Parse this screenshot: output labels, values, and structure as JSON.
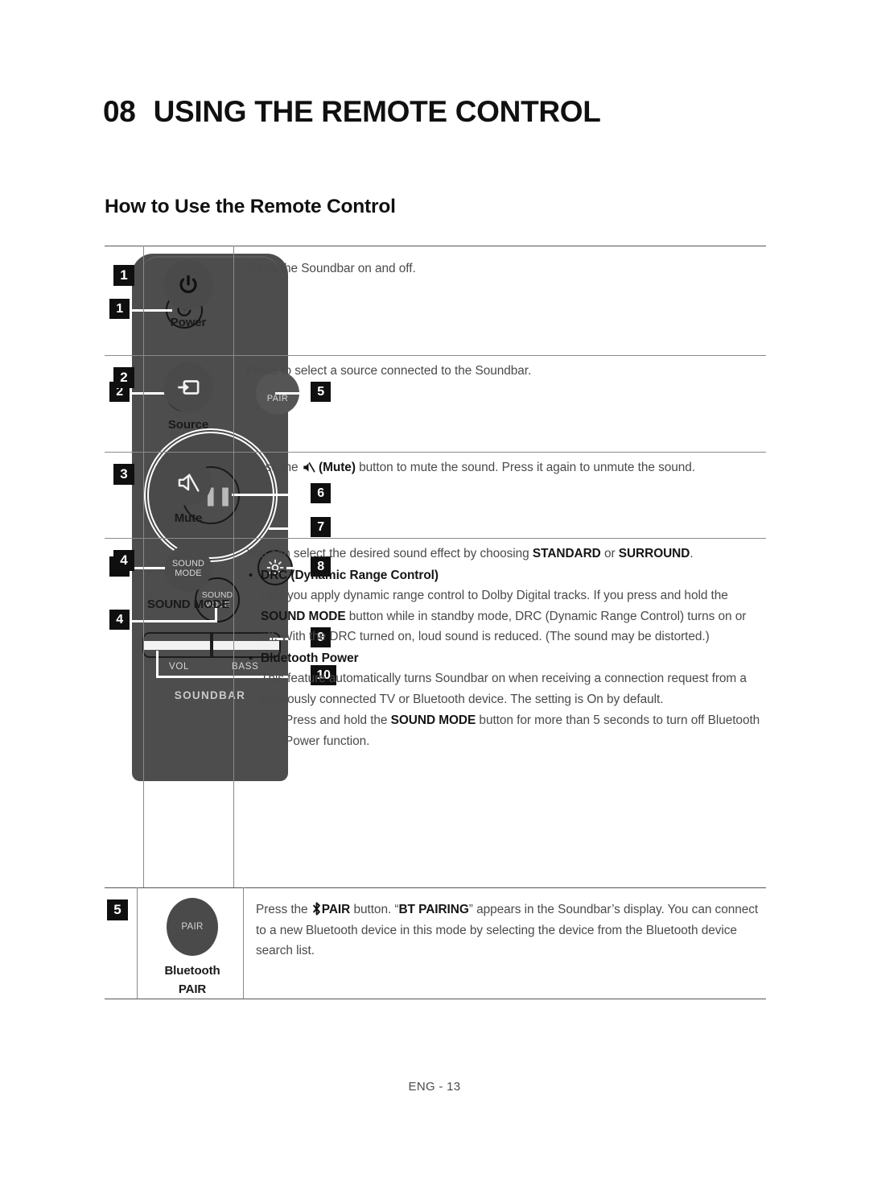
{
  "header": {
    "chapter_number": "08",
    "chapter_title": "USING THE REMOTE CONTROL",
    "section_title": "How to Use the Remote Control"
  },
  "remote_figure": {
    "brand_label": "SOUNDBAR",
    "pair_button_label": "PAIR",
    "sound_mode_label_line1": "SOUND",
    "sound_mode_label_line2": "MODE",
    "vol_label": "VOL",
    "bass_label": "BASS",
    "play_pause_glyph": "▶❚❚",
    "callouts": [
      {
        "number": "1",
        "target": "power-button"
      },
      {
        "number": "2",
        "target": "source-button"
      },
      {
        "number": "3",
        "target": "mute-button"
      },
      {
        "number": "4",
        "target": "sound-mode-button"
      },
      {
        "number": "5",
        "target": "pair-button"
      },
      {
        "number": "6",
        "target": "play-pause-button"
      },
      {
        "number": "7",
        "target": "navigation-ring"
      },
      {
        "number": "8",
        "target": "settings-button"
      },
      {
        "number": "9",
        "target": "volume-bass-rocker"
      },
      {
        "number": "10",
        "target": "rocker-lower-edge"
      }
    ]
  },
  "table": {
    "rows": [
      {
        "number": "1",
        "button_caption": "Power",
        "icon": "power-icon",
        "description": "Turns the Soundbar on and off."
      },
      {
        "number": "2",
        "button_caption": "Source",
        "icon": "source-icon",
        "description": "Press to select a source connected to the Soundbar."
      },
      {
        "number": "3",
        "button_caption": "Mute",
        "icon": "mute-icon",
        "desc_part1": "Press the ",
        "desc_mute_bold": "(Mute)",
        "desc_part2": " button to mute the sound. Press it again to unmute the sound."
      },
      {
        "number": "4",
        "button_caption": "SOUND MODE",
        "icon": "sound-mode-icon",
        "button_label_line1": "SOUND",
        "button_label_line2": "MODE",
        "intro_a": "You can select the desired sound effect by choosing ",
        "intro_standard": "STANDARD",
        "intro_or": " or ",
        "intro_surround": "SURROUND",
        "intro_end": ".",
        "bullet1_heading": "DRC (Dynamic Range Control)",
        "bullet1_text_a": "Lets you apply dynamic range control to Dolby Digital tracks. If you press and hold the ",
        "bullet1_bold": "SOUND MODE",
        "bullet1_text_b": " button while in standby mode, DRC (Dynamic Range Control) turns on or off. With the DRC turned on, loud sound is reduced. (The sound may be distorted.)",
        "bullet2_heading": "Bluetooth Power",
        "bullet2_text": "This feature automatically turns Soundbar on when receiving a connection request from a previously connected TV or Bluetooth device. The setting is On by default.",
        "bullet2_sub_a": "Press and hold the ",
        "bullet2_sub_bold": "SOUND MODE",
        "bullet2_sub_b": " button for more than 5 seconds to turn off Bluetooth Power function."
      },
      {
        "number": "5",
        "button_caption_line1": "Bluetooth",
        "button_caption_line2": "PAIR",
        "button_label": "PAIR",
        "icon": "bluetooth-icon",
        "desc_a": "Press the ",
        "desc_pair_bold": "PAIR",
        "desc_b": " button. “",
        "desc_bt_pairing_bold": "BT PAIRING",
        "desc_c": "” appears in the Soundbar’s display. You can connect to a new Bluetooth device in this mode by selecting the device from the Bluetooth device search list."
      }
    ]
  },
  "footer": {
    "page_label": "ENG - 13"
  }
}
